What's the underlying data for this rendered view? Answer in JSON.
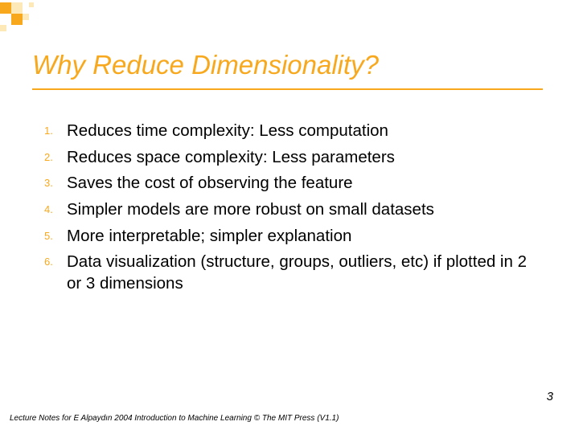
{
  "title": "Why Reduce Dimensionality?",
  "items": [
    {
      "num": "1.",
      "text": "Reduces time complexity: Less computation"
    },
    {
      "num": "2.",
      "text": "Reduces space complexity: Less parameters"
    },
    {
      "num": "3.",
      "text": "Saves the cost of observing the feature"
    },
    {
      "num": "4.",
      "text": "Simpler models are more robust on small datasets"
    },
    {
      "num": "5.",
      "text": "More interpretable; simpler explanation"
    },
    {
      "num": "6.",
      "text": "Data visualization (structure, groups, outliers, etc) if plotted in 2 or 3 dimensions"
    }
  ],
  "footer": "Lecture Notes for E Alpaydın 2004 Introduction to Machine Learning © The MIT Press (V1.1)",
  "page": "3"
}
